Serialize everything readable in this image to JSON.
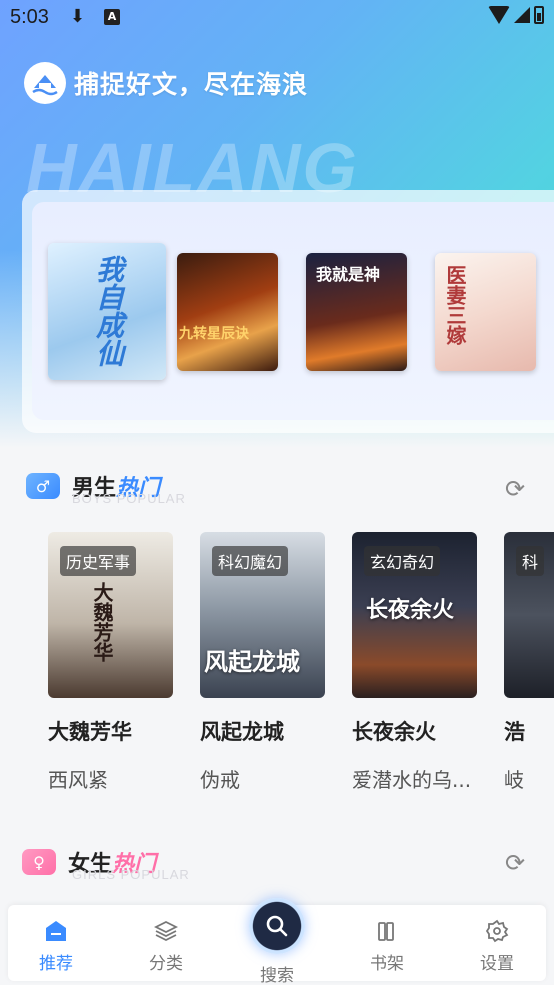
{
  "status": {
    "time": "5:03",
    "download_icon": "download-icon",
    "a_badge": "A"
  },
  "header": {
    "slogan": "捕捉好文，尽在海浪",
    "watermark": "HAILANG"
  },
  "banner": {
    "books": [
      {
        "title": "我自成仙",
        "badge": ""
      },
      {
        "title": "九转星辰诀",
        "badge": ""
      },
      {
        "title": "我就是神",
        "badge": ""
      },
      {
        "title": "医妻三嫁",
        "badge": ""
      }
    ]
  },
  "boys": {
    "title_prefix": "男生",
    "title_highlight": "热门",
    "subtitle": "BOYS POPULAR",
    "books": [
      {
        "tag": "历史军事",
        "title": "大魏芳华",
        "author": "西风紧",
        "cover_text": "大魏芳华"
      },
      {
        "tag": "科幻魔幻",
        "title": "风起龙城",
        "author": "伪戒",
        "cover_text": "风起龙城"
      },
      {
        "tag": "玄幻奇幻",
        "title": "长夜余火",
        "author": "爱潜水的乌...",
        "cover_text": "长夜余火"
      },
      {
        "tag": "科",
        "title": "浩",
        "author": "岐",
        "cover_text": ""
      }
    ]
  },
  "girls": {
    "title_prefix": "女生",
    "title_highlight": "热门",
    "subtitle": "GIRLS POPULAR"
  },
  "tabs": [
    {
      "label": "推荐",
      "icon": "home-icon",
      "active": true
    },
    {
      "label": "分类",
      "icon": "layers-icon",
      "active": false
    },
    {
      "label": "搜索",
      "icon": "search-icon",
      "active": false
    },
    {
      "label": "书架",
      "icon": "bookshelf-icon",
      "active": false
    },
    {
      "label": "设置",
      "icon": "gear-icon",
      "active": false
    }
  ],
  "colors": {
    "accent": "#3a8bff",
    "hero_start": "#6fa2ff",
    "hero_end": "#44dcc9",
    "girls_accent": "#ff6fa8"
  }
}
